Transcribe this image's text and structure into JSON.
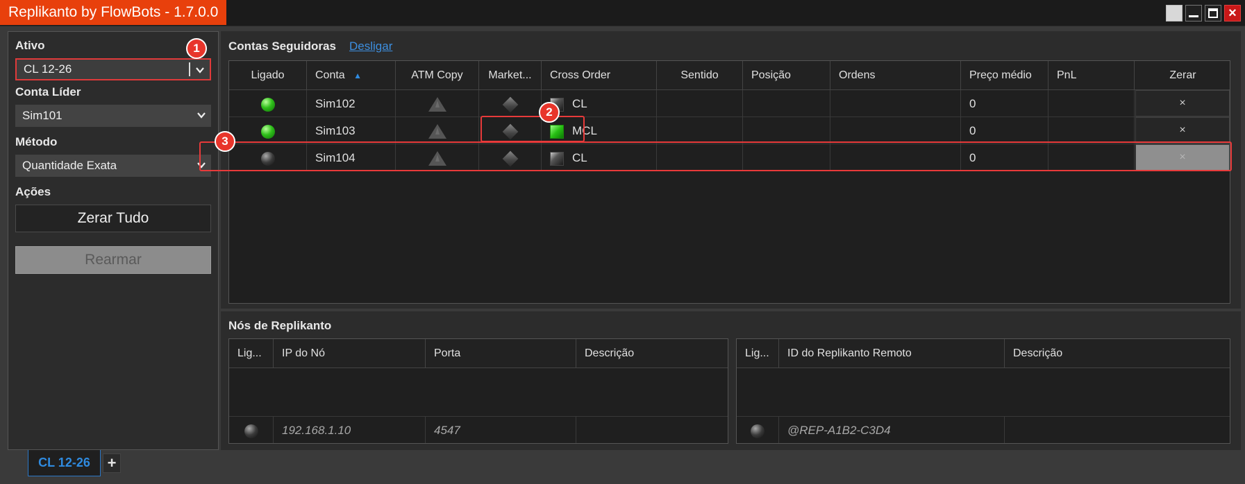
{
  "window": {
    "title": "Replikanto by FlowBots - 1.7.0.0"
  },
  "left": {
    "ativo_label": "Ativo",
    "ativo_value": "CL 12-26",
    "conta_lider_label": "Conta Líder",
    "conta_lider_value": "Sim101",
    "metodo_label": "Método",
    "metodo_value": "Quantidade Exata",
    "acoes_label": "Ações",
    "zerar_tudo": "Zerar Tudo",
    "rearmar": "Rearmar"
  },
  "followers": {
    "title": "Contas Seguidoras",
    "link": "Desligar",
    "columns": [
      "Ligado",
      "Conta",
      "ATM Copy",
      "Market...",
      "Cross Order",
      "Sentido",
      "Posição",
      "Ordens",
      "Preço médio",
      "PnL",
      "Zerar"
    ],
    "sort_indicator": "▲",
    "rows": [
      {
        "ligado": "on",
        "conta": "Sim102",
        "cross_color": "gray",
        "cross": "CL",
        "preco_medio": "0",
        "zerar": "×"
      },
      {
        "ligado": "on",
        "conta": "Sim103",
        "cross_color": "green",
        "cross": "MCL",
        "preco_medio": "0",
        "zerar": "×"
      },
      {
        "ligado": "off",
        "conta": "Sim104",
        "cross_color": "gray",
        "cross": "CL",
        "preco_medio": "0",
        "zerar": "×"
      }
    ]
  },
  "nodes": {
    "title": "Nós de Replikanto",
    "left_columns": [
      "Lig...",
      "IP do Nó",
      "Porta",
      "Descrição"
    ],
    "left_row": {
      "ip": "192.168.1.10",
      "porta": "4547",
      "descricao": ""
    },
    "right_columns": [
      "Lig...",
      "ID do Replikanto Remoto",
      "Descrição"
    ],
    "right_row": {
      "id": "@REP-A1B2-C3D4",
      "descricao": ""
    }
  },
  "badges": [
    "1",
    "2",
    "3"
  ],
  "tabs": {
    "active": "CL 12-26",
    "add": "+"
  },
  "colors": {
    "accent": "#e8400c",
    "highlight": "#e83a3a",
    "link": "#3d8fe0"
  }
}
